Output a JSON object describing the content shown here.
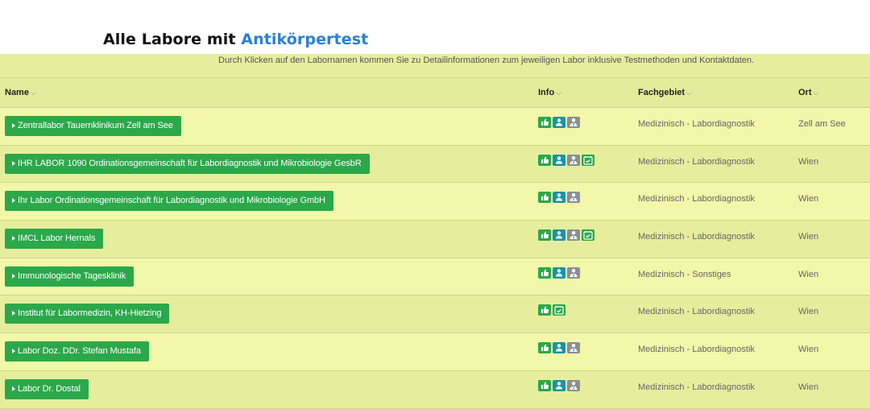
{
  "heading": {
    "prefix": "Alle Labore mit ",
    "highlight": "Antikörpertest"
  },
  "hint": "Durch Klicken auf den Labornamen kommen Sie zu Detailinformationen zum jeweiligen Labor inklusive Testmethoden und Kontaktdaten.",
  "columns": {
    "name": "Name",
    "info": "Info",
    "fach": "Fachgebiet",
    "ort": "Ort",
    "chevron": "⌵"
  },
  "colors": {
    "accent": "#2ba84a",
    "heading_highlight": "#2a80d8",
    "row_odd": "#f2f7a9",
    "row_even": "#e6ee9d"
  },
  "rows": [
    {
      "name": "Zentrallabor Tauernklinikum Zell am See",
      "icons": [
        "thumbs-up-icon",
        "person-icon",
        "doctor-icon"
      ],
      "fach": "Medizinisch - Labordiagnostik",
      "ort": "Zell am See"
    },
    {
      "name": "IHR LABOR 1090 Ordinationsgemeinschaft für Labordiagnostik und Mikrobiologie GesbR",
      "icons": [
        "thumbs-up-icon",
        "person-icon",
        "doctor-icon",
        "calendar-check-icon"
      ],
      "fach": "Medizinisch - Labordiagnostik",
      "ort": "Wien"
    },
    {
      "name": "Ihr Labor Ordinationsgemeinschaft für Labordiagnostik und Mikrobiologie GmbH",
      "icons": [
        "thumbs-up-icon",
        "person-icon",
        "doctor-icon"
      ],
      "fach": "Medizinisch - Labordiagnostik",
      "ort": "Wien"
    },
    {
      "name": "IMCL Labor Hernals",
      "icons": [
        "thumbs-up-icon",
        "person-icon",
        "doctor-icon",
        "calendar-check-icon"
      ],
      "fach": "Medizinisch - Labordiagnostik",
      "ort": "Wien"
    },
    {
      "name": "Immunologische Tagesklinik",
      "icons": [
        "thumbs-up-icon",
        "person-icon",
        "doctor-icon"
      ],
      "fach": "Medizinisch - Sonstiges",
      "ort": "Wien"
    },
    {
      "name": "Institut für Labormedizin, KH-Hietzing",
      "icons": [
        "thumbs-up-icon",
        "calendar-check-icon"
      ],
      "fach": "Medizinisch - Labordiagnostik",
      "ort": "Wien"
    },
    {
      "name": "Labor Doz. DDr. Stefan Mustafa",
      "icons": [
        "thumbs-up-icon",
        "person-icon",
        "doctor-icon"
      ],
      "fach": "Medizinisch - Labordiagnostik",
      "ort": "Wien"
    },
    {
      "name": "Labor Dr. Dostal",
      "icons": [
        "thumbs-up-icon",
        "person-icon",
        "doctor-icon"
      ],
      "fach": "Medizinisch - Labordiagnostik",
      "ort": "Wien"
    }
  ]
}
